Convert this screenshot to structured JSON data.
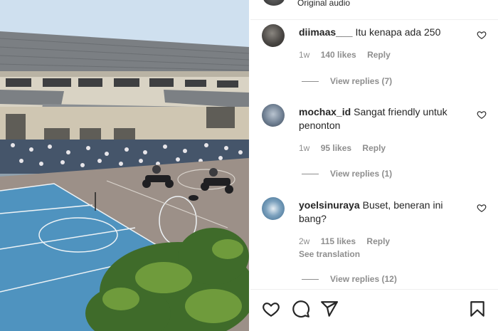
{
  "header": {
    "audio_label": "Original audio"
  },
  "comments": [
    {
      "username": "diimaas___",
      "text": "Itu kenapa ada 250",
      "age": "1w",
      "likes": "140 likes",
      "reply_label": "Reply",
      "view_replies": "View replies (7)"
    },
    {
      "username": "mochax_id",
      "text": "Sangat friendly untuk penonton",
      "age": "1w",
      "likes": "95 likes",
      "reply_label": "Reply",
      "view_replies": "View replies (1)"
    },
    {
      "username": "yoelsinuraya",
      "text": "Buset, beneran ini bang?",
      "age": "2w",
      "likes": "115 likes",
      "reply_label": "Reply",
      "see_translation": "See translation",
      "view_replies": "View replies (12)"
    }
  ],
  "icons": {
    "like": "heart-icon",
    "comment": "comment-bubble-icon",
    "share": "paper-plane-icon",
    "save": "bookmark-icon",
    "comment_like": "small-heart-icon"
  },
  "colors": {
    "text": "#262626",
    "secondary": "#8e8e8e",
    "divider": "#efefef",
    "court_blue": "#4f93bf"
  }
}
